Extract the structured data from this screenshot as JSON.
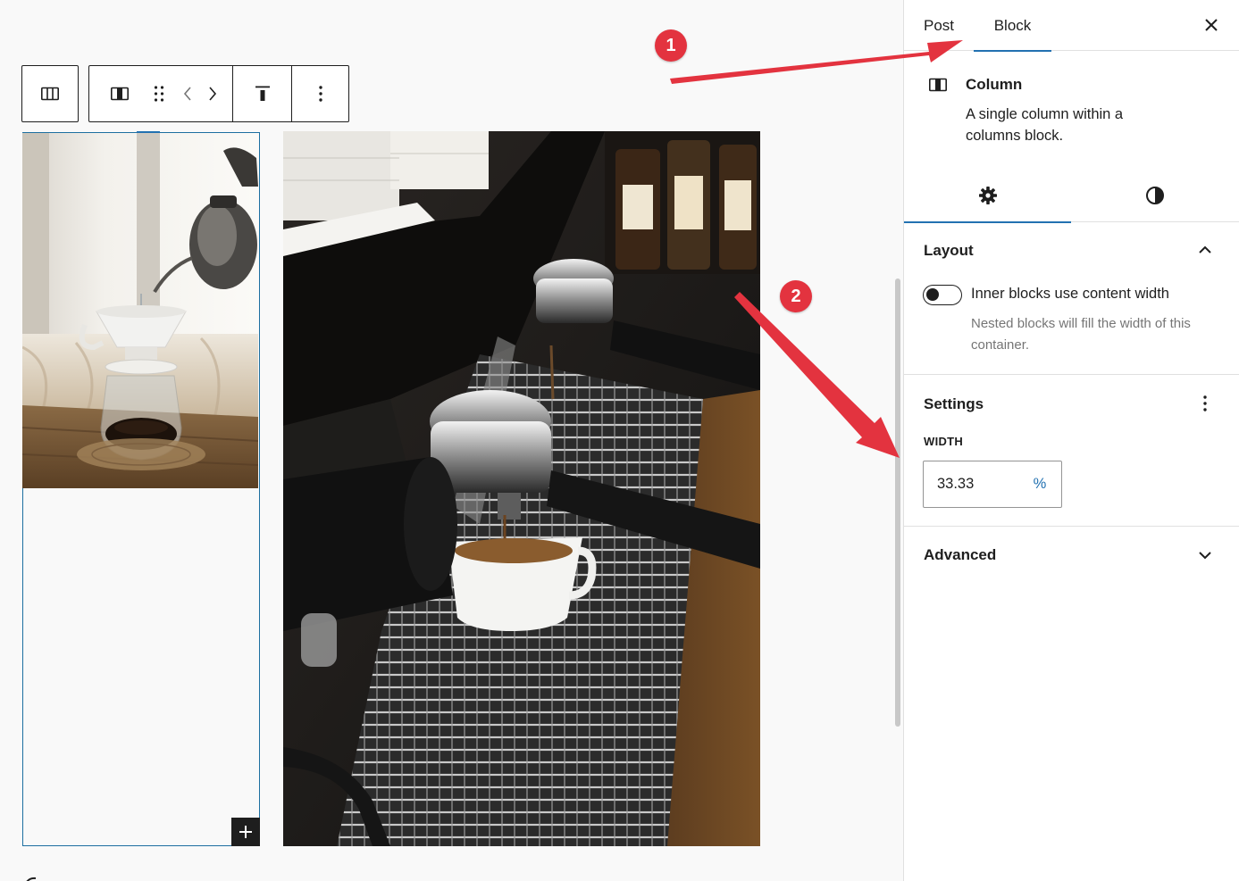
{
  "sidebar": {
    "tabs": [
      {
        "label": "Post",
        "active": false
      },
      {
        "label": "Block",
        "active": true
      }
    ],
    "block_card": {
      "title": "Column",
      "description": "A single column within a columns block."
    },
    "subtabs": [
      {
        "icon": "gear-icon",
        "active": true
      },
      {
        "icon": "half-circle-icon",
        "active": false
      }
    ],
    "layout_panel": {
      "title": "Layout",
      "toggle_label": "Inner blocks use content width",
      "toggle_on": false,
      "help_text": "Nested blocks will fill the width of this container."
    },
    "settings_panel": {
      "title": "Settings",
      "width_label": "WIDTH",
      "width_value": "33.33",
      "width_unit": "%"
    },
    "advanced_panel": {
      "title": "Advanced"
    }
  },
  "toolbar": {
    "parent_icon": "columns-icon",
    "items": [
      "column-icon",
      "drag-handle-icon",
      "move-left-icon",
      "move-right-icon",
      "align-top-icon",
      "more-options-icon"
    ]
  },
  "annotations": {
    "badge_1": "1",
    "badge_2": "2"
  },
  "colors": {
    "accent": "#2271b1",
    "annotation_red": "#e3333f",
    "selection_border": "#1d6fa0"
  }
}
